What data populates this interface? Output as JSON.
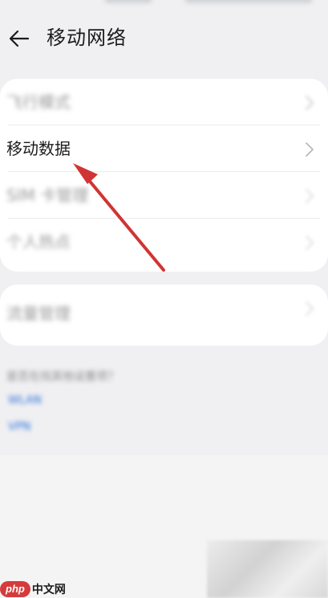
{
  "header": {
    "title": "移动网络"
  },
  "card1": {
    "items": [
      {
        "label": "飞行模式",
        "blurred": true
      },
      {
        "label": "移动数据",
        "blurred": false
      },
      {
        "label": "SIM 卡管理",
        "blurred": true
      },
      {
        "label": "个人热点",
        "blurred": true
      }
    ]
  },
  "card2": {
    "items": [
      {
        "label": "流量管理",
        "blurred": true
      }
    ]
  },
  "footer": {
    "note": "是否在找其他设置项？",
    "link1": "WLAN",
    "link2": "VPN"
  },
  "watermark": {
    "badge": "php",
    "text": "中文网"
  },
  "colors": {
    "background": "#f0f0f2",
    "card": "#ffffff",
    "arrow": "#d03434",
    "link": "#2a6fdb"
  },
  "icons": {
    "back": "arrow-left-icon",
    "chevron": "chevron-right-icon"
  }
}
